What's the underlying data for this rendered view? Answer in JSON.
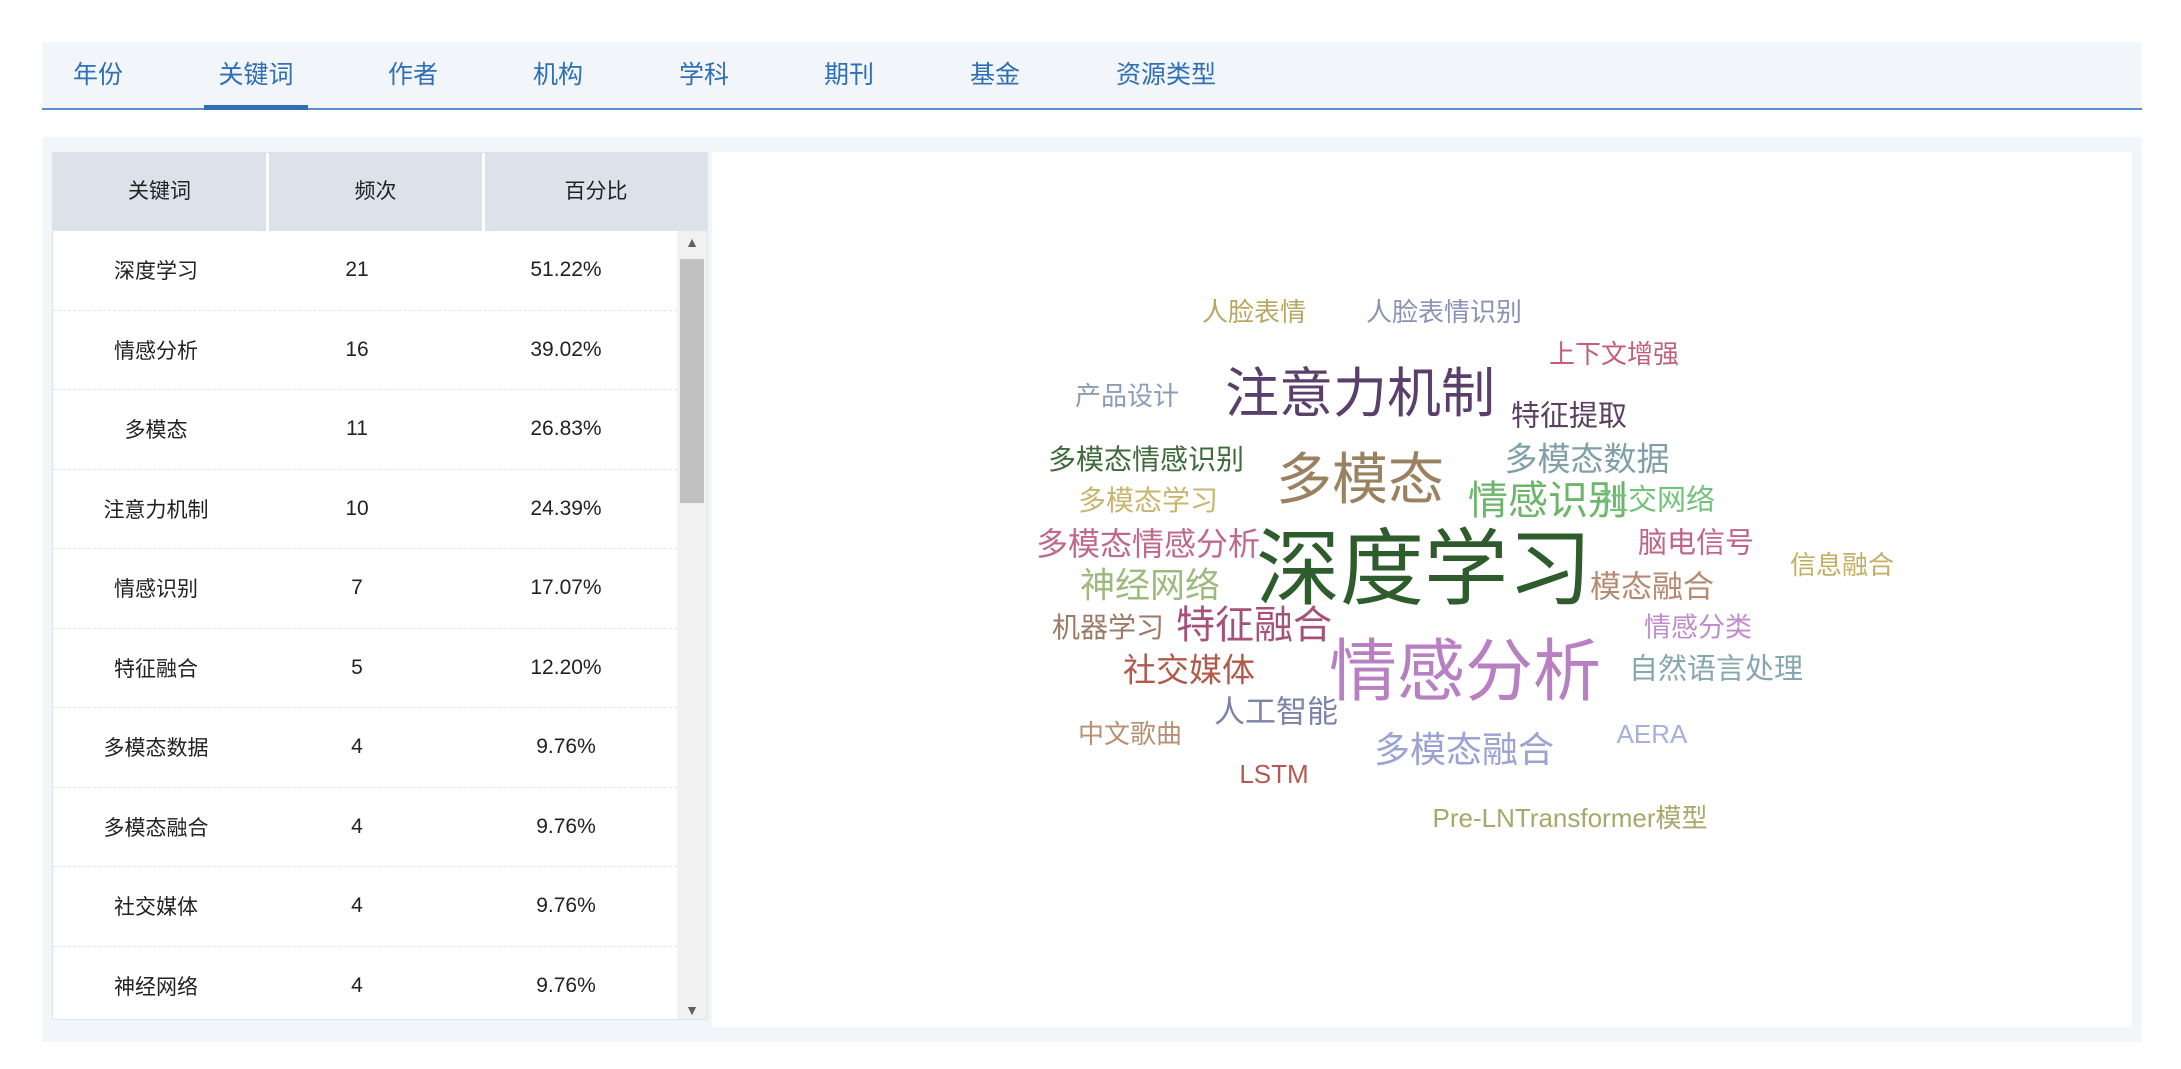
{
  "tabs": [
    {
      "label": "年份",
      "active": false
    },
    {
      "label": "关键词",
      "active": true
    },
    {
      "label": "作者",
      "active": false
    },
    {
      "label": "机构",
      "active": false
    },
    {
      "label": "学科",
      "active": false
    },
    {
      "label": "期刊",
      "active": false
    },
    {
      "label": "基金",
      "active": false
    },
    {
      "label": "资源类型",
      "active": false
    }
  ],
  "table": {
    "headers": {
      "keyword": "关键词",
      "frequency": "频次",
      "percentage": "百分比"
    },
    "rows": [
      {
        "keyword": "深度学习",
        "frequency": "21",
        "percentage": "51.22%"
      },
      {
        "keyword": "情感分析",
        "frequency": "16",
        "percentage": "39.02%"
      },
      {
        "keyword": "多模态",
        "frequency": "11",
        "percentage": "26.83%"
      },
      {
        "keyword": "注意力机制",
        "frequency": "10",
        "percentage": "24.39%"
      },
      {
        "keyword": "情感识别",
        "frequency": "7",
        "percentage": "17.07%"
      },
      {
        "keyword": "特征融合",
        "frequency": "5",
        "percentage": "12.20%"
      },
      {
        "keyword": "多模态数据",
        "frequency": "4",
        "percentage": "9.76%"
      },
      {
        "keyword": "多模态融合",
        "frequency": "4",
        "percentage": "9.76%"
      },
      {
        "keyword": "社交媒体",
        "frequency": "4",
        "percentage": "9.76%"
      },
      {
        "keyword": "神经网络",
        "frequency": "4",
        "percentage": "9.76%"
      }
    ]
  },
  "word_cloud": [
    {
      "text": "人脸表情",
      "color": "#b8a763"
    },
    {
      "text": "人脸表情识别",
      "color": "#8a93b3"
    },
    {
      "text": "上下文增强",
      "color": "#c2607c"
    },
    {
      "text": "产品设计",
      "color": "#8c9bb8"
    },
    {
      "text": "注意力机制",
      "color": "#5b3f6b"
    },
    {
      "text": "特征提取",
      "color": "#5a3f5f"
    },
    {
      "text": "多模态情感识别",
      "color": "#3d6b3a"
    },
    {
      "text": "多模态",
      "color": "#9a8260"
    },
    {
      "text": "多模态数据",
      "color": "#7fa0a6"
    },
    {
      "text": "多模态学习",
      "color": "#c8b66e"
    },
    {
      "text": "情感识别",
      "color": "#6db56a"
    },
    {
      "text": "社交网络",
      "color": "#72c27a"
    },
    {
      "text": "多模态情感分析",
      "color": "#c06a8a"
    },
    {
      "text": "深度学习",
      "color": "#2f5c2c"
    },
    {
      "text": "脑电信号",
      "color": "#c26584"
    },
    {
      "text": "信息融合",
      "color": "#c4ad62"
    },
    {
      "text": "神经网络",
      "color": "#9cba7c"
    },
    {
      "text": "模态融合",
      "color": "#b78a72"
    },
    {
      "text": "机器学习",
      "color": "#9b7a67"
    },
    {
      "text": "特征融合",
      "color": "#a5527a"
    },
    {
      "text": "情感分类",
      "color": "#c08ccb"
    },
    {
      "text": "情感分析",
      "color": "#b87fc2"
    },
    {
      "text": "社交媒体",
      "color": "#b05a4a"
    },
    {
      "text": "自然语言处理",
      "color": "#84a8ad"
    },
    {
      "text": "人工智能",
      "color": "#7c82a8"
    },
    {
      "text": "中文歌曲",
      "color": "#b89071"
    },
    {
      "text": "AERA",
      "color": "#a8b0d8"
    },
    {
      "text": "多模态融合",
      "color": "#9ba3d4"
    },
    {
      "text": "LSTM",
      "color": "#b25a52"
    },
    {
      "text": "Pre-LNTransformer模型",
      "color": "#a6a96a"
    }
  ],
  "colors": {
    "accent": "#2f6fb6",
    "header_bg": "#dce2ea",
    "panel_bg": "#f2f6fb"
  }
}
